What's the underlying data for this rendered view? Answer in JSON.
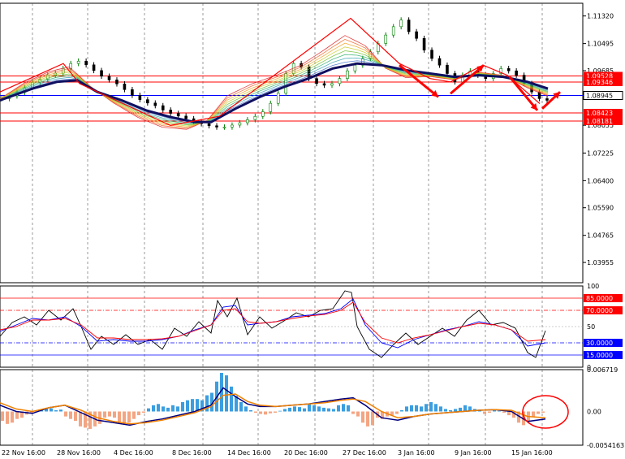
{
  "chart_data": [
    {
      "type": "line",
      "panel": "price",
      "title": "",
      "ylim": [
        1.0335,
        1.117
      ],
      "y_ticks": [
        "1.11320",
        "1.10495",
        "1.09685",
        "1.08055",
        "1.07225",
        "1.06400",
        "1.05590",
        "1.04765",
        "1.03955"
      ],
      "y_tick_values": [
        1.1132,
        1.10495,
        1.09685,
        1.08055,
        1.07225,
        1.064,
        1.0559,
        1.04765,
        1.03955
      ],
      "horizontal_levels": [
        {
          "label": "1.09528",
          "value": 1.09528,
          "color": "#ff0000"
        },
        {
          "label": "1.09346",
          "value": 1.09346,
          "color": "#ff0000"
        },
        {
          "label": "1.08945",
          "value": 1.08945,
          "color": "#0000ff"
        },
        {
          "label": "1.08423",
          "value": 1.08423,
          "color": "#ff0000"
        },
        {
          "label": "1.08181",
          "value": 1.08181,
          "color": "#ff0000"
        }
      ],
      "x_labels": [
        "22 Nov 16:00",
        "28 Nov 16:00",
        "4 Dec 16:00",
        "8 Dec 16:00",
        "14 Dec 16:00",
        "20 Dec 16:00",
        "27 Dec 16:00",
        "3 Jan 16:00",
        "9 Jan 16:00",
        "15 Jan 16:00"
      ],
      "series": [
        {
          "color": "#101060",
          "x": [
            0,
            40,
            70,
            95,
            120,
            150,
            180,
            210,
            240,
            260,
            290,
            320,
            350,
            380,
            410,
            440,
            470,
            500,
            530,
            560,
            590,
            620,
            650,
            675
          ],
          "values": [
            1.088,
            1.0915,
            1.0935,
            1.094,
            1.0905,
            1.088,
            1.085,
            1.083,
            1.0815,
            1.0815,
            1.0855,
            1.089,
            1.092,
            1.0945,
            1.0975,
            1.099,
            1.0985,
            1.097,
            1.096,
            1.095,
            1.0955,
            1.095,
            1.0935,
            1.0915
          ]
        },
        {
          "color": "#d0a020",
          "x": [
            0,
            30,
            60,
            85,
            110,
            140,
            170,
            200,
            230,
            255,
            280,
            310,
            340,
            370,
            400,
            425,
            450,
            475,
            500,
            530,
            560,
            590,
            620,
            650,
            675
          ],
          "values": [
            1.0885,
            1.0935,
            1.097,
            1.0985,
            1.0925,
            1.087,
            1.0825,
            1.0795,
            1.079,
            1.082,
            1.09,
            1.0935,
            1.096,
            1.099,
            1.104,
            1.1085,
            1.105,
            1.0975,
            1.0945,
            1.095,
            1.094,
            1.0965,
            1.0955,
            1.0915,
            1.089
          ]
        }
      ],
      "candles_close": [
        1.0885,
        1.0893,
        1.0904,
        1.0918,
        1.0934,
        1.0943,
        1.0955,
        1.0961,
        1.0975,
        1.099,
        1.0997,
        1.0986,
        1.0969,
        1.0952,
        1.0941,
        1.0929,
        1.0912,
        1.0895,
        1.0882,
        1.0872,
        1.0864,
        1.0851,
        1.0841,
        1.0833,
        1.0825,
        1.0816,
        1.081,
        1.0804,
        1.08,
        1.08,
        1.0806,
        1.0813,
        1.0822,
        1.0832,
        1.0846,
        1.0871,
        1.0901,
        1.096,
        1.099,
        1.098,
        1.0945,
        1.093,
        1.0925,
        1.093,
        1.0945,
        1.0968,
        1.0985,
        1.1005,
        1.1025,
        1.105,
        1.1075,
        1.11,
        1.112,
        1.1085,
        1.1065,
        1.103,
        1.1005,
        1.0985,
        1.096,
        1.0935,
        1.0955,
        1.0968,
        1.0955,
        1.0945,
        1.096,
        1.0975,
        1.0968,
        1.0955,
        1.093,
        1.0905,
        1.0885,
        1.088
      ]
    },
    {
      "type": "line",
      "panel": "oscillator",
      "ylim": [
        0,
        100
      ],
      "y_ticks": [
        "100",
        "50",
        "0"
      ],
      "y_tick_values": [
        100,
        50,
        0
      ],
      "levels": [
        {
          "label": "85.0000",
          "value": 85,
          "color": "#ff0000"
        },
        {
          "label": "70.0000",
          "value": 70,
          "color": "#ff0000"
        },
        {
          "label": "30.0000",
          "value": 30,
          "color": "#0000ff"
        },
        {
          "label": "15.0000",
          "value": 15,
          "color": "#0000ff"
        }
      ],
      "series": [
        {
          "color": "#000000",
          "x": [
            0,
            15,
            30,
            45,
            60,
            75,
            90,
            100,
            112,
            125,
            140,
            155,
            170,
            185,
            200,
            215,
            230,
            245,
            260,
            268,
            280,
            292,
            305,
            320,
            335,
            350,
            365,
            380,
            395,
            410,
            425,
            433,
            440,
            455,
            470,
            485,
            500,
            515,
            530,
            545,
            560,
            575,
            590,
            605,
            620,
            635,
            650,
            660,
            672
          ],
          "values": [
            38,
            55,
            62,
            52,
            70,
            58,
            72,
            50,
            22,
            38,
            28,
            40,
            28,
            34,
            22,
            48,
            38,
            56,
            42,
            82,
            62,
            85,
            40,
            62,
            48,
            57,
            67,
            62,
            70,
            72,
            94,
            92,
            50,
            22,
            12,
            28,
            42,
            28,
            38,
            48,
            38,
            58,
            70,
            52,
            55,
            48,
            18,
            12,
            45
          ]
        },
        {
          "color": "#0000ff",
          "x": [
            0,
            20,
            40,
            60,
            80,
            100,
            120,
            140,
            160,
            180,
            200,
            220,
            240,
            260,
            275,
            290,
            305,
            320,
            340,
            360,
            380,
            400,
            420,
            435,
            450,
            470,
            490,
            510,
            530,
            550,
            570,
            590,
            610,
            630,
            650,
            672
          ],
          "values": [
            44,
            52,
            60,
            58,
            62,
            50,
            32,
            34,
            32,
            32,
            34,
            38,
            46,
            52,
            74,
            76,
            52,
            54,
            56,
            62,
            64,
            66,
            72,
            84,
            52,
            30,
            24,
            34,
            40,
            46,
            50,
            56,
            52,
            46,
            26,
            30
          ]
        },
        {
          "color": "#ff0000",
          "x": [
            0,
            20,
            40,
            60,
            80,
            100,
            120,
            140,
            160,
            180,
            200,
            220,
            240,
            260,
            275,
            290,
            305,
            320,
            340,
            360,
            380,
            400,
            420,
            435,
            450,
            470,
            490,
            510,
            530,
            550,
            570,
            590,
            610,
            630,
            650,
            672
          ],
          "values": [
            46,
            50,
            58,
            58,
            60,
            52,
            36,
            36,
            34,
            34,
            35,
            38,
            45,
            52,
            70,
            72,
            56,
            54,
            56,
            60,
            63,
            65,
            70,
            80,
            55,
            36,
            30,
            36,
            40,
            45,
            50,
            54,
            52,
            46,
            32,
            34
          ]
        }
      ]
    },
    {
      "type": "bar",
      "panel": "histogram",
      "ylim": [
        -0.0054163,
        0.0067194
      ],
      "y_ticks": [
        "0.006719",
        "0.00",
        "-0.0054163"
      ],
      "y_tick_values": [
        0.006719,
        0.0,
        -0.0054163
      ],
      "x": [
        0,
        6,
        12,
        18,
        24,
        30,
        36,
        42,
        48,
        54,
        60,
        66,
        72,
        78,
        84,
        90,
        96,
        102,
        108,
        114,
        120,
        126,
        132,
        138,
        144,
        150,
        156,
        162,
        168,
        174,
        180,
        186,
        192,
        198,
        204,
        210,
        216,
        222,
        228,
        234,
        240,
        246,
        252,
        258,
        264,
        270,
        276,
        282,
        288,
        294,
        300,
        306,
        312,
        318,
        324,
        330,
        336,
        342,
        348,
        354,
        360,
        366,
        372,
        378,
        384,
        390,
        396,
        402,
        408,
        414,
        420,
        426,
        432,
        438,
        444,
        450,
        456,
        462,
        468,
        474,
        480,
        486,
        492,
        498,
        504,
        510,
        516,
        522,
        528,
        534,
        540,
        546,
        552,
        558,
        564,
        570,
        576,
        582,
        588,
        594,
        600,
        606,
        612,
        618,
        624,
        630,
        636,
        642,
        648,
        654,
        660,
        666
      ],
      "values": [
        -0.0015,
        -0.002,
        -0.0018,
        -0.0012,
        -0.001,
        -0.0005,
        -0.0003,
        -0.0001,
        0.0002,
        0.0005,
        0.0005,
        0.0002,
        0.0003,
        -0.0008,
        -0.0012,
        -0.0015,
        -0.0024,
        -0.0026,
        -0.0028,
        -0.0024,
        -0.002,
        -0.001,
        -0.0008,
        -0.001,
        -0.0018,
        -0.002,
        -0.0018,
        -0.0012,
        -0.0006,
        -0.0002,
        0.0005,
        0.001,
        0.0012,
        0.0008,
        0.0006,
        0.001,
        0.0008,
        0.0015,
        0.0018,
        0.002,
        0.002,
        0.0018,
        0.0026,
        0.003,
        0.0048,
        0.0062,
        0.0058,
        0.004,
        0.0025,
        0.0015,
        0.0008,
        0.0002,
        -0.0002,
        -0.0004,
        -0.0005,
        -0.0003,
        -0.0002,
        0.0001,
        0.0004,
        0.0006,
        0.0008,
        0.0007,
        0.0005,
        0.0012,
        0.001,
        0.0008,
        0.0006,
        0.0005,
        0.0004,
        0.001,
        0.0012,
        0.001,
        -0.0004,
        -0.0008,
        -0.0018,
        -0.0024,
        -0.0022,
        -0.001,
        -0.0012,
        -0.0008,
        -0.0006,
        -0.0004,
        0.0002,
        0.0008,
        0.001,
        0.001,
        0.0008,
        0.0012,
        0.0015,
        0.0012,
        0.0008,
        0.0004,
        0.0002,
        0.0004,
        0.0006,
        0.001,
        0.0008,
        0.0004,
        0.0002,
        -0.0004,
        -0.0002,
        0.0002,
        0.0001,
        -0.0002,
        -0.0006,
        -0.001,
        -0.0018,
        -0.0022,
        -0.0016,
        -0.0008,
        -0.0004,
        -0.0002
      ],
      "pos_color": "#3a9ee0",
      "neg_color": "#f4a582",
      "series": [
        {
          "color": "#000080",
          "x": [
            0,
            20,
            40,
            60,
            80,
            100,
            120,
            140,
            160,
            180,
            200,
            220,
            240,
            260,
            275,
            290,
            305,
            320,
            340,
            360,
            380,
            400,
            420,
            435,
            450,
            470,
            490,
            510,
            530,
            550,
            570,
            590,
            610,
            630,
            650,
            672
          ],
          "values": [
            0.001,
            0.0,
            -0.0003,
            0.0006,
            0.001,
            -0.0002,
            -0.0014,
            -0.0018,
            -0.0022,
            -0.0016,
            -0.0012,
            -0.0006,
            0.0,
            0.001,
            0.0038,
            0.0024,
            0.0012,
            0.0008,
            0.0008,
            0.001,
            0.0012,
            0.0016,
            0.002,
            0.0022,
            0.001,
            -0.001,
            -0.0014,
            -0.0008,
            -0.0004,
            -0.0002,
            0.0,
            0.0002,
            0.0003,
            0.0,
            -0.0016,
            -0.0012
          ]
        },
        {
          "color": "#f08000",
          "x": [
            0,
            20,
            40,
            60,
            80,
            100,
            120,
            140,
            160,
            180,
            200,
            220,
            240,
            260,
            275,
            290,
            305,
            320,
            340,
            360,
            380,
            400,
            420,
            435,
            450,
            470,
            490,
            510,
            530,
            550,
            570,
            590,
            610,
            630,
            650,
            672
          ],
          "values": [
            0.0014,
            0.0004,
            0.0,
            0.0006,
            0.001,
            0.0002,
            -0.001,
            -0.0016,
            -0.002,
            -0.0018,
            -0.0014,
            -0.0008,
            -0.0002,
            0.0008,
            0.0026,
            0.0028,
            0.0016,
            0.001,
            0.0008,
            0.001,
            0.0012,
            0.0014,
            0.0018,
            0.002,
            0.0016,
            0.0,
            -0.001,
            -0.0008,
            -0.0004,
            -0.0002,
            0.0,
            0.0002,
            0.0003,
            0.0002,
            -0.0008,
            -0.001
          ]
        }
      ]
    }
  ]
}
